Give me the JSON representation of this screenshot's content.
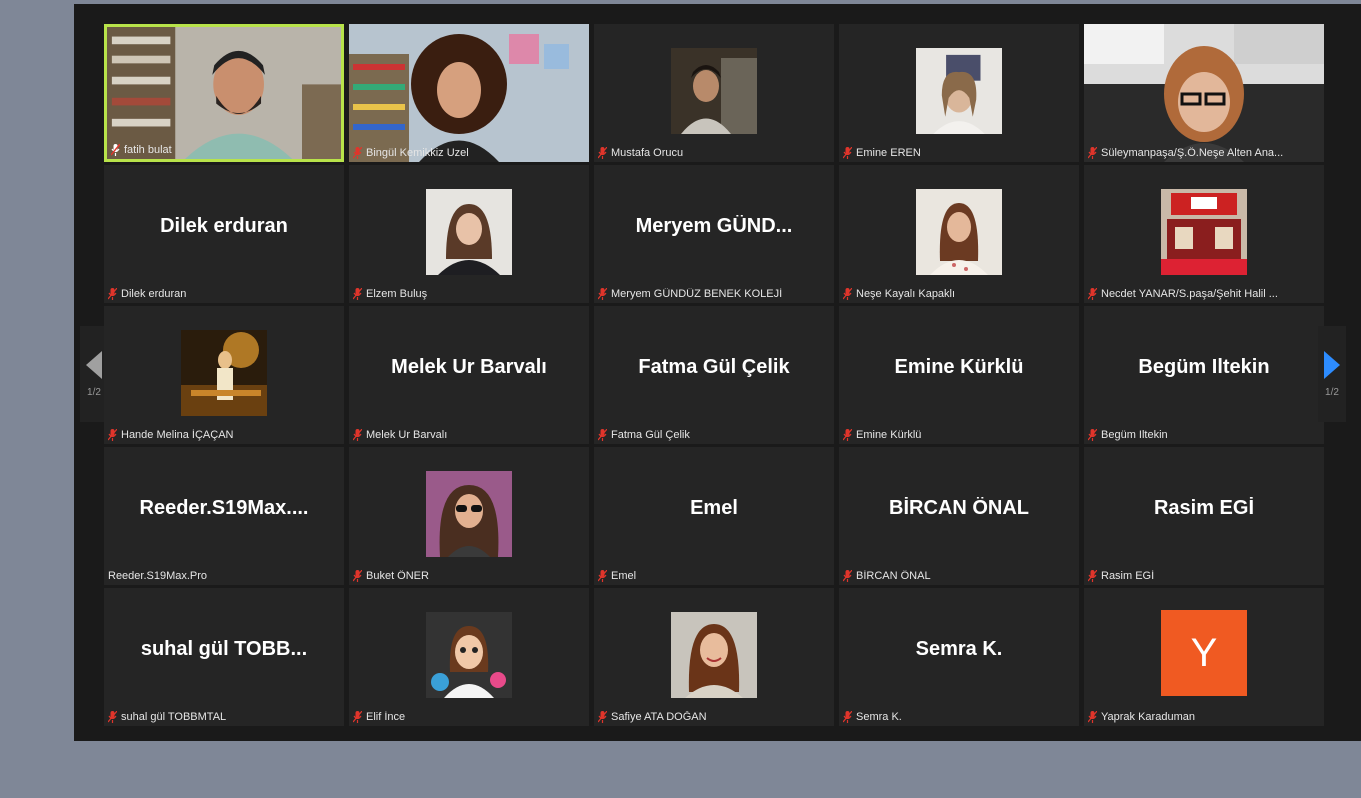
{
  "participants": [
    {
      "label": "fatih bulat",
      "big": "",
      "thumb": "man",
      "active": true
    },
    {
      "label": "Bingül Kemikkiz Uzel",
      "big": "",
      "thumb": "woman-curly"
    },
    {
      "label": "Mustafa Orucu",
      "big": "",
      "thumb": "small-dark"
    },
    {
      "label": "Emine EREN",
      "big": "",
      "thumb": "woman-light"
    },
    {
      "label": "Süleymanpaşa/Ş.Ö.Neşe Alten Ana...",
      "big": "",
      "thumb": "woman-glasses"
    },
    {
      "label": "Dilek erduran",
      "big": "Dilek erduran",
      "thumb": ""
    },
    {
      "label": "Elzem Buluş",
      "big": "",
      "thumb": "woman-dark"
    },
    {
      "label": "Meryem GÜNDÜZ BENEK KOLEJİ",
      "big": "Meryem GÜND...",
      "thumb": ""
    },
    {
      "label": "Neşe Kayalı Kapaklı",
      "big": "",
      "thumb": "woman-light2"
    },
    {
      "label": "Necdet YANAR/S.paşa/Şehit Halil ...",
      "big": "",
      "thumb": "room-red"
    },
    {
      "label": "Hande Melina İÇAÇAN",
      "big": "",
      "thumb": "night"
    },
    {
      "label": "Melek Ur Barvalı",
      "big": "Melek Ur Barvalı",
      "thumb": ""
    },
    {
      "label": "Fatma Gül Çelik",
      "big": "Fatma Gül Çelik",
      "thumb": ""
    },
    {
      "label": "Emine Kürklü",
      "big": "Emine Kürklü",
      "thumb": ""
    },
    {
      "label": "Begüm Iltekin",
      "big": "Begüm Iltekin",
      "thumb": ""
    },
    {
      "label": "Reeder.S19Max.Pro",
      "big": "Reeder.S19Max....",
      "thumb": "",
      "nomic": true
    },
    {
      "label": "Buket ÖNER",
      "big": "",
      "thumb": "woman-sunglasses"
    },
    {
      "label": "Emel",
      "big": "Emel",
      "thumb": ""
    },
    {
      "label": "BİRCAN ÖNAL",
      "big": "BİRCAN ÖNAL",
      "thumb": ""
    },
    {
      "label": "Rasim EGİ",
      "big": "Rasim EGİ",
      "thumb": ""
    },
    {
      "label": "suhal gül TOBBMTAL",
      "big": "suhal gül TOBB...",
      "thumb": ""
    },
    {
      "label": "Elif İnce",
      "big": "",
      "thumb": "cartoon"
    },
    {
      "label": "Safiye ATA DOĞAN",
      "big": "",
      "thumb": "woman-smile"
    },
    {
      "label": "Semra K.",
      "big": "Semra K.",
      "thumb": ""
    },
    {
      "label": "Yaprak Karaduman",
      "big": "",
      "thumb": "",
      "letter": "Y"
    }
  ],
  "nav": {
    "prev_page": "1/2",
    "next_page": "1/2"
  },
  "colors": {
    "active_border": "#b8e34a",
    "mic_muted": "#e0352b",
    "next_arrow": "#2d8cff",
    "avatar_bg": "#f05a22"
  }
}
